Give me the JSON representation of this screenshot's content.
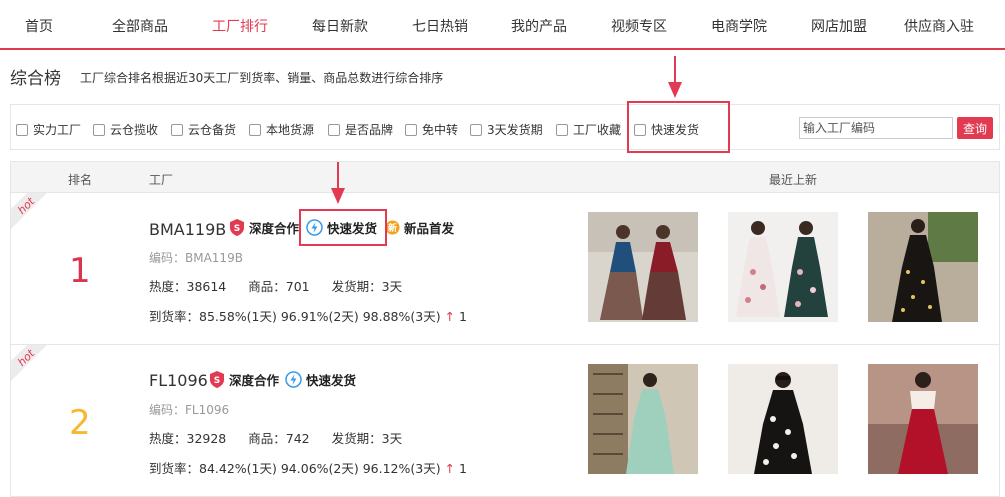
{
  "nav": {
    "items": [
      {
        "label": "首页",
        "active": false
      },
      {
        "label": "全部商品",
        "active": false
      },
      {
        "label": "工厂排行",
        "active": true
      },
      {
        "label": "每日新款",
        "active": false
      },
      {
        "label": "七日热销",
        "active": false
      },
      {
        "label": "我的产品",
        "active": false
      },
      {
        "label": "视频专区",
        "active": false
      },
      {
        "label": "电商学院",
        "active": false
      },
      {
        "label": "网店加盟",
        "active": false
      },
      {
        "label": "供应商入驻",
        "active": false
      }
    ]
  },
  "header": {
    "title": "综合榜",
    "subtitle": "工厂综合排名根据近30天工厂到货率、销量、商品总数进行综合排序"
  },
  "filters": {
    "items": [
      "实力工厂",
      "云仓揽收",
      "云仓备货",
      "本地货源",
      "是否品牌",
      "免中转",
      "3天发货期",
      "工厂收藏",
      "快速发货"
    ],
    "search_placeholder": "输入工厂编码",
    "search_button": "查询"
  },
  "table": {
    "headers": {
      "rank": "排名",
      "factory": "工厂",
      "latest": "最近上新"
    },
    "hot_label": "hot",
    "rows": [
      {
        "rank": "1",
        "name": "BMA119B",
        "tags": [
          "深度合作",
          "快速发货",
          "新品首发"
        ],
        "code": "编码：BMA119B",
        "heat": "热度：38614",
        "products": "商品：701",
        "ship": "发货期：3天",
        "rate1": "到货率：85.58%(1天)",
        "rate2": "96.91%(2天)",
        "rate3": "98.88%(3天)",
        "trend": "↑",
        "trend_value": "1"
      },
      {
        "rank": "2",
        "name": "FL1096",
        "tags": [
          "深度合作",
          "快速发货"
        ],
        "code": "编码：FL1096",
        "heat": "热度：32928",
        "products": "商品：742",
        "ship": "发货期：3天",
        "rate1": "到货率：84.42%(1天)",
        "rate2": "94.06%(2天)",
        "rate3": "96.12%(3天)",
        "trend": "↑",
        "trend_value": "1"
      }
    ]
  },
  "colors": {
    "accent": "#e23a50",
    "rank2": "#f5b82e",
    "badge_blue": "#3a9ae8",
    "badge_gold": "#f1a31c"
  }
}
